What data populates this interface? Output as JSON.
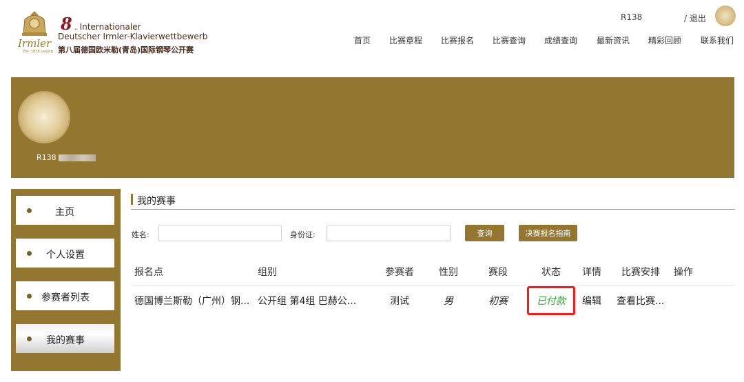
{
  "header": {
    "logo": {
      "number": "8",
      "line1": ". Internationaler",
      "line2": "Deutscher Irmler-Klavierwettbewerb",
      "line3": "第八届德国欧米勒(青岛)国际钢琴公开赛",
      "script": "Irmler",
      "est": "Est. 1818 Leipzig"
    },
    "user_id": "R138",
    "logout": "/ 退出",
    "nav": [
      "首页",
      "比赛章程",
      "比赛报名",
      "比赛查询",
      "成绩查询",
      "最新资讯",
      "精彩回顾",
      "联系我们"
    ]
  },
  "banner": {
    "user_id": "R138"
  },
  "sidebar": {
    "items": [
      {
        "label": "主页"
      },
      {
        "label": "个人设置"
      },
      {
        "label": "参赛者列表"
      },
      {
        "label": "我的赛事"
      }
    ],
    "active": "我的赛事"
  },
  "main": {
    "section_title": "我的赛事",
    "filters": {
      "name_label": "姓名:",
      "name_value": "",
      "id_label": "身份证:",
      "id_value": "",
      "query_button": "查询",
      "guide_button": "决赛报名指南"
    },
    "table": {
      "headers": [
        "报名点",
        "组别",
        "参赛者",
        "性别",
        "赛段",
        "状态",
        "详情",
        "比赛安排",
        "操作"
      ],
      "rows": [
        {
          "site": "德国博兰斯勒（广州）钢...",
          "group": "公开组 第4组 巴赫公...",
          "participant": "测试",
          "gender": "男",
          "stage": "初赛",
          "status": "已付款",
          "detail": "编辑",
          "schedule": "查看比赛...",
          "action": ""
        }
      ]
    }
  },
  "colors": {
    "brand": "#937630",
    "paid": "#2aa72a",
    "highlight": "#ff1a1a"
  }
}
